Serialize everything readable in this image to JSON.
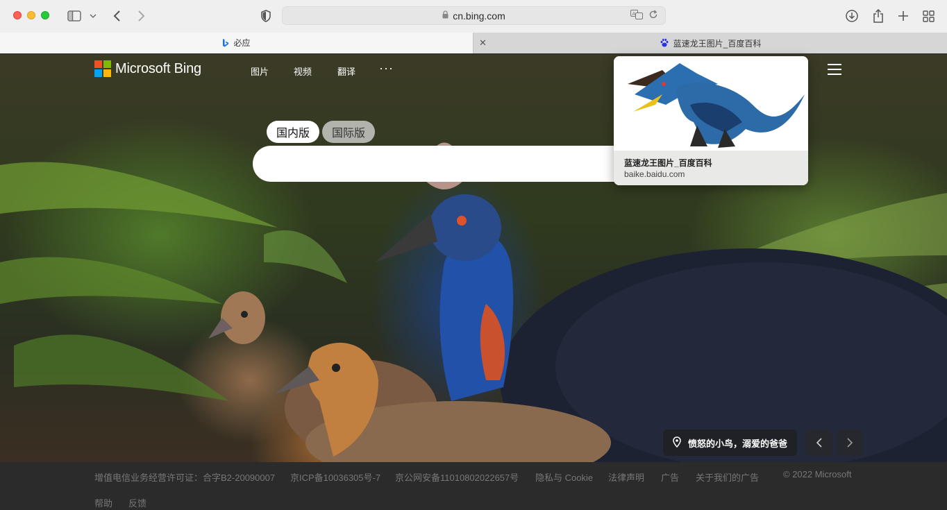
{
  "browser": {
    "url": "cn.bing.com",
    "tabs": [
      {
        "title": "必应",
        "active": true
      },
      {
        "title": "蓝速龙王图片_百度百科",
        "active": false
      }
    ]
  },
  "bing": {
    "logo_text": "Microsoft Bing",
    "nav": {
      "images": "图片",
      "videos": "视频",
      "translate": "翻译",
      "more": "···"
    },
    "scope": {
      "domestic": "国内版",
      "international": "国际版"
    },
    "search_placeholder": "",
    "caption": "愤怒的小鸟，溺爱的爸爸",
    "colors": {
      "ms_red": "#f25022",
      "ms_green": "#7fba00",
      "ms_blue": "#00a4ef",
      "ms_yellow": "#ffb900"
    }
  },
  "preview": {
    "title": "蓝速龙王图片_百度百科",
    "url": "baike.baidu.com"
  },
  "footer": {
    "license": "增值电信业务经营许可证：合字B2-20090007",
    "icp": "京ICP备10036305号-7",
    "police": "京公网安备11010802022657号",
    "privacy": "隐私与 Cookie",
    "legal": "法律声明",
    "ads": "广告",
    "about_ads": "关于我们的广告",
    "copyright": "© 2022 Microsoft",
    "help": "帮助",
    "feedback": "反馈"
  }
}
